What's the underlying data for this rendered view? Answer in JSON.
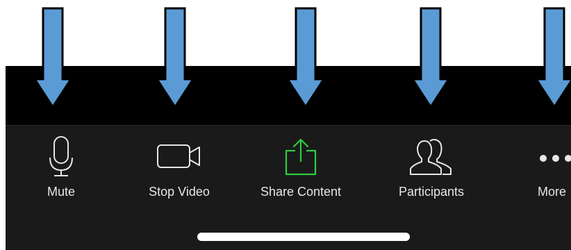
{
  "toolbar": {
    "buttons": [
      {
        "label": "Mute",
        "icon": "microphone-icon"
      },
      {
        "label": "Stop Video",
        "icon": "video-camera-icon"
      },
      {
        "label": "Share Content",
        "icon": "share-upload-icon"
      },
      {
        "label": "Participants",
        "icon": "participants-icon"
      },
      {
        "label": "More",
        "icon": "more-dots-icon"
      }
    ]
  },
  "colors": {
    "arrow_fill": "#5b9bd5",
    "arrow_outline": "#000000",
    "toolbar_bg": "#1a1a1a",
    "band_bg": "#000000",
    "share_accent": "#2ecc40",
    "label_color": "#e6e6e6",
    "home_indicator": "#ffffff"
  }
}
